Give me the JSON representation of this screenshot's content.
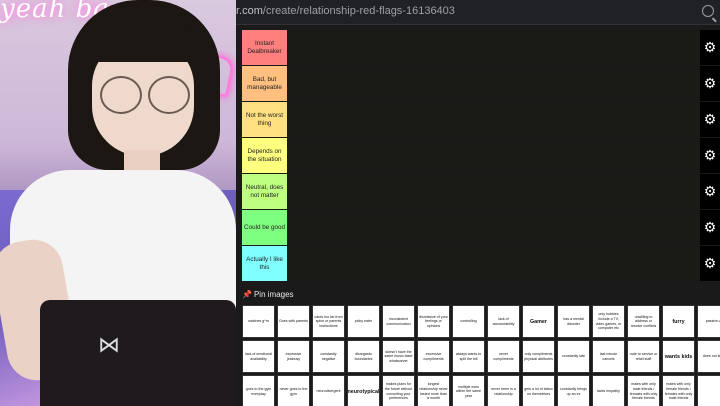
{
  "browser": {
    "url_prefix": "r.com",
    "url_path": "/create/relationship-red-flags-16136403"
  },
  "webcam": {
    "neon_text": "yeah ba"
  },
  "tiers": [
    {
      "label": "Instant Dealbreaker",
      "color": "#ff7f7f"
    },
    {
      "label": "Bad, but manageable",
      "color": "#ffbf7f"
    },
    {
      "label": "Not the worst thing",
      "color": "#ffdf7f"
    },
    {
      "label": "Depends on the situation",
      "color": "#ffff7f"
    },
    {
      "label": "Neutral, does not matter",
      "color": "#bfff7f"
    },
    {
      "label": "Could be good",
      "color": "#7fff7f"
    },
    {
      "label": "Actually I like this",
      "color": "#7fffff"
    }
  ],
  "pin_title": "Pin images",
  "pins": [
    {
      "text": "watches g*rn",
      "big": false
    },
    {
      "text": "Goes with parents",
      "big": false
    },
    {
      "text": "cares too far from spice or parents instructions",
      "big": false
    },
    {
      "text": "picky eater",
      "big": false
    },
    {
      "text": "inconsistent communication",
      "big": false
    },
    {
      "text": "dismissive of your feelings or opinions",
      "big": false
    },
    {
      "text": "controlling",
      "big": false
    },
    {
      "text": "lack of accountability",
      "big": false
    },
    {
      "text": "Gamer",
      "big": true
    },
    {
      "text": "has a mental disorder",
      "big": false
    },
    {
      "text": "only hobbies include a TV, video games, or computer etc",
      "big": false
    },
    {
      "text": "unwilling to address or resolve conflicts",
      "big": false
    },
    {
      "text": "furry",
      "big": true
    },
    {
      "text": "passive-a",
      "big": false
    },
    {
      "text": "lack of emotional availability",
      "big": false
    },
    {
      "text": "excessive jealousy",
      "big": false
    },
    {
      "text": "constantly negative",
      "big": false
    },
    {
      "text": "disregards boundaries",
      "big": false
    },
    {
      "text": "doesn't have the same music taste whatsoever",
      "big": false
    },
    {
      "text": "excessive compliments",
      "big": false
    },
    {
      "text": "always wants to split the bill",
      "big": false
    },
    {
      "text": "never compliments",
      "big": false
    },
    {
      "text": "only compliments physical attributes",
      "big": false
    },
    {
      "text": "constantly late",
      "big": false
    },
    {
      "text": "last minute cancels",
      "big": false
    },
    {
      "text": "rude to service or retail staff",
      "big": false
    },
    {
      "text": "wants kids",
      "big": true
    },
    {
      "text": "does not kids",
      "big": false
    },
    {
      "text": "goes to the gym everyday",
      "big": false
    },
    {
      "text": "never goes to the gym",
      "big": false
    },
    {
      "text": "neurodivergent",
      "big": false
    },
    {
      "text": "neurotypical",
      "big": true
    },
    {
      "text": "makes plans for the future without consulting your preferences",
      "big": false
    },
    {
      "text": "longest relationship never lasted more than a month",
      "big": false
    },
    {
      "text": "multiple exes within the same year",
      "big": false
    },
    {
      "text": "never been in a relationship",
      "big": false
    },
    {
      "text": "gets a lot of tattoo on themselves",
      "big": false
    },
    {
      "text": "constantly brings up an ex",
      "big": false
    },
    {
      "text": "lacks empathy",
      "big": false
    },
    {
      "text": "males with only male friends / females with only female friends",
      "big": false
    },
    {
      "text": "males with only female friends / females with only male friends",
      "big": false
    },
    {
      "text": "",
      "big": false
    }
  ],
  "icons": {
    "gear": "gear-icon",
    "zoom": "zoom-icon",
    "pin": "pin-icon"
  }
}
